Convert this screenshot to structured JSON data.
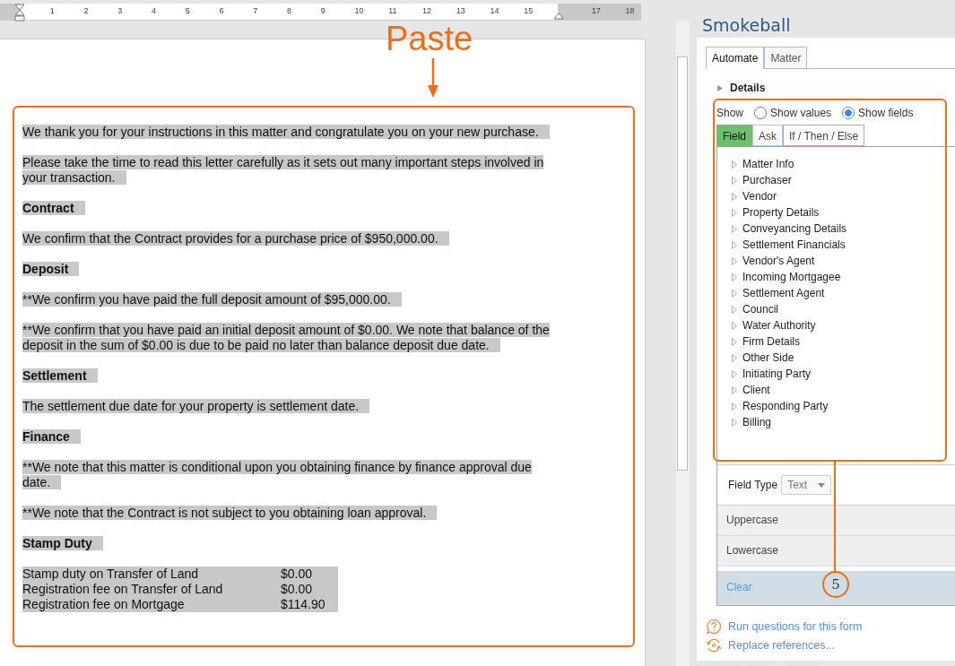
{
  "ruler": {
    "marks": [
      "1",
      "2",
      "3",
      "4",
      "5",
      "6",
      "7",
      "8",
      "9",
      "10",
      "11",
      "12",
      "13",
      "14",
      "15",
      "17",
      "18"
    ]
  },
  "annotations": {
    "paste_label": "Paste",
    "callout_number": "5"
  },
  "document": {
    "blocks": [
      {
        "kind": "paragraph",
        "text": "We thank you for your instructions in this matter and congratulate you on your new purchase."
      },
      {
        "kind": "paragraph",
        "text": "Please take the time to read this letter carefully as it sets out many important steps involved in your transaction."
      },
      {
        "kind": "heading",
        "text": "Contract"
      },
      {
        "kind": "paragraph",
        "text": "We confirm that the Contract provides for a purchase price of $950,000.00."
      },
      {
        "kind": "heading",
        "text": "Deposit"
      },
      {
        "kind": "paragraph",
        "text": "**We confirm you have paid the full deposit amount of $95,000.00."
      },
      {
        "kind": "paragraph",
        "text": "**We confirm that you have paid an initial deposit amount of $0.00. We note that balance of the deposit in the sum of $0.00 is due to be paid no later than balance deposit due date."
      },
      {
        "kind": "heading",
        "text": "Settlement"
      },
      {
        "kind": "paragraph",
        "text": "The settlement due date for your property is settlement date."
      },
      {
        "kind": "heading",
        "text": "Finance"
      },
      {
        "kind": "paragraph",
        "text": "**We note that this matter is conditional upon you obtaining finance by finance approval due date."
      },
      {
        "kind": "paragraph",
        "text": "**We note that the Contract is not subject to you obtaining loan approval."
      },
      {
        "kind": "heading",
        "text": "Stamp Duty"
      },
      {
        "kind": "fees",
        "rows": [
          {
            "label": "Stamp duty on Transfer of Land",
            "amount": "$0.00"
          },
          {
            "label": "Registration fee on Transfer of Land",
            "amount": "$0.00"
          },
          {
            "label": "Registration fee on Mortgage",
            "amount": "$114.90"
          }
        ]
      }
    ]
  },
  "panel": {
    "title": "Smokeball",
    "tabs": [
      {
        "label": "Automate",
        "selected": true
      },
      {
        "label": "Matter",
        "selected": false
      }
    ],
    "section": "Details",
    "show": {
      "label": "Show",
      "options": [
        {
          "label": "Show values",
          "selected": false
        },
        {
          "label": "Show fields",
          "selected": true
        }
      ]
    },
    "subtabs": [
      {
        "label": "Field",
        "selected": true
      },
      {
        "label": "Ask",
        "selected": false
      },
      {
        "label": "If / Then / Else",
        "selected": false
      }
    ],
    "tree": [
      "Matter Info",
      "Purchaser",
      "Vendor",
      "Property Details",
      "Conveyancing Details",
      "Settlement Financials",
      "Vendor's Agent",
      "Incoming Mortgagee",
      "Settlement Agent",
      "Council",
      "Water Authority",
      "Firm Details",
      "Other Side",
      "Initiating Party",
      "Client",
      "Responding Party",
      "Billing"
    ],
    "field_type": {
      "label": "Field Type",
      "value": "Text"
    },
    "options": [
      {
        "label": "Uppercase",
        "selected": false
      },
      {
        "label": "Lowercase",
        "selected": false
      },
      {
        "label": "Clear",
        "selected": true
      }
    ],
    "links": [
      {
        "kind": "question",
        "label": "Run questions for this form"
      },
      {
        "kind": "replace",
        "label": "Replace references..."
      }
    ]
  }
}
